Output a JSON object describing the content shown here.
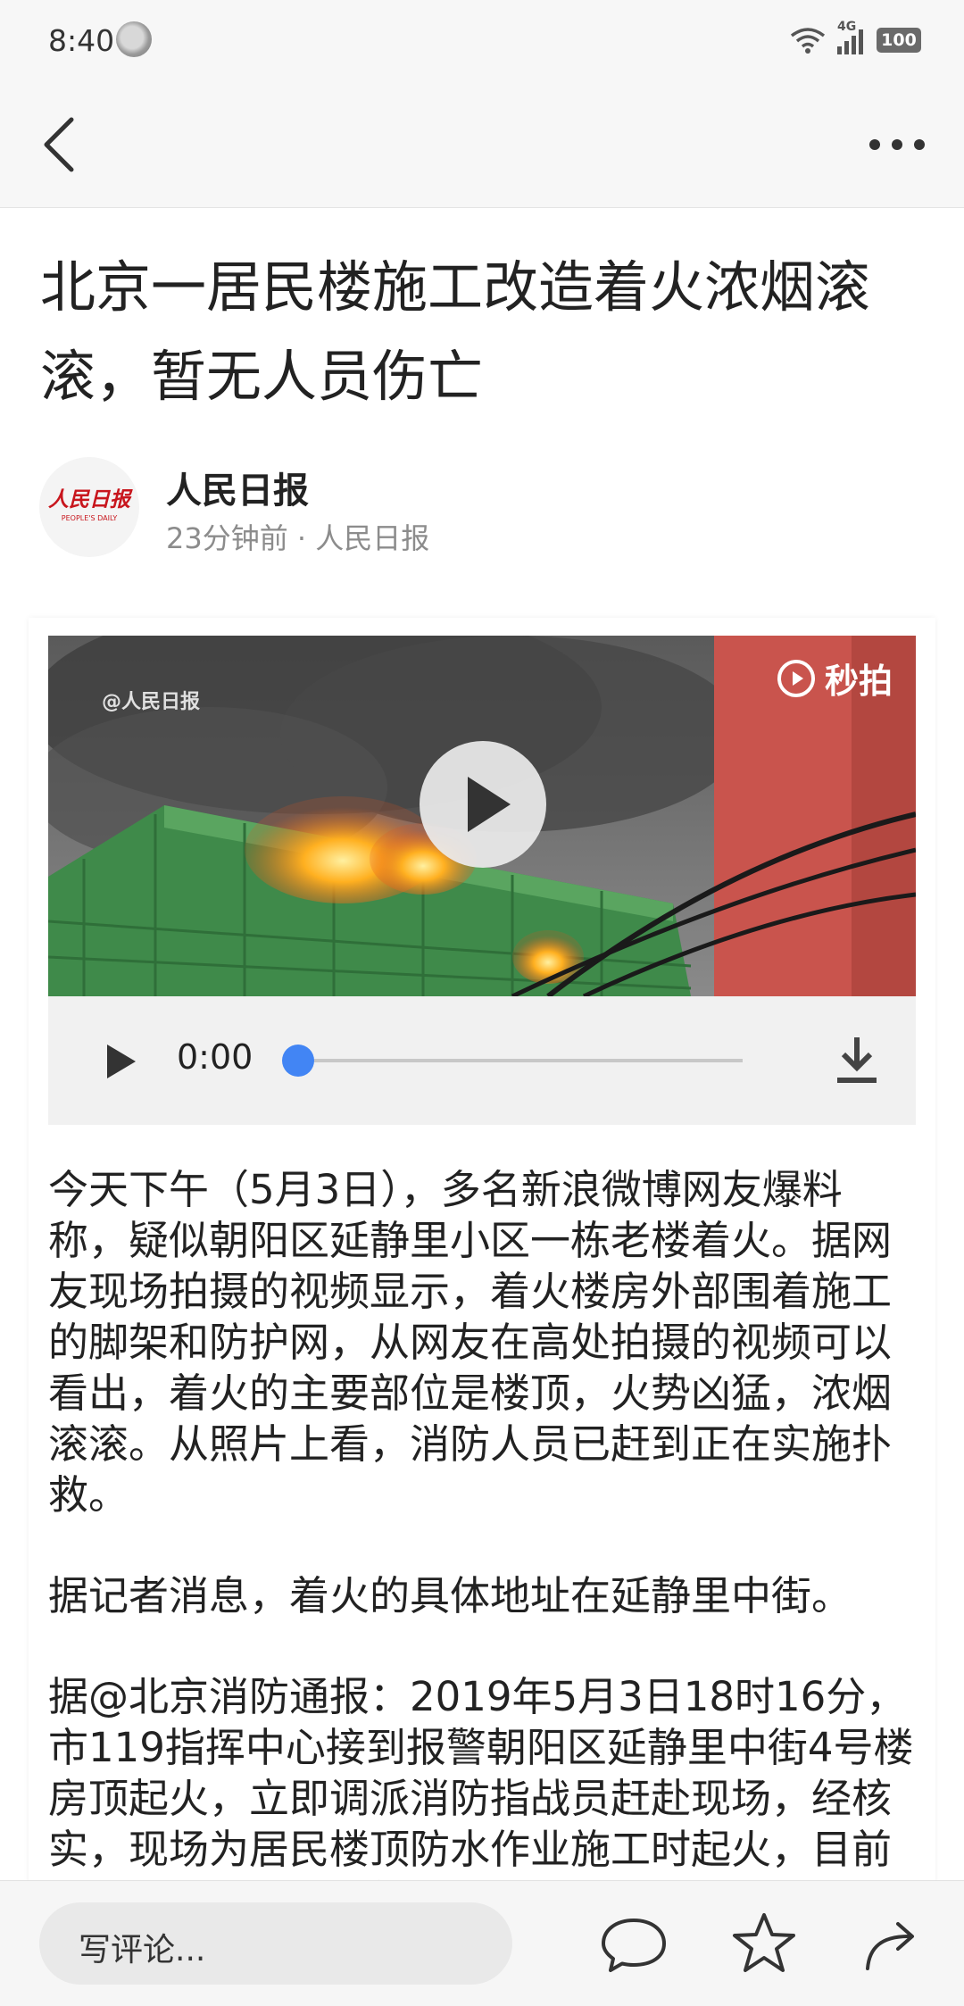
{
  "status_bar": {
    "time": "8:40",
    "network": "4G",
    "battery": "100"
  },
  "nav": {
    "back_icon": "chevron-left-icon",
    "more_icon": "more-horizontal-icon"
  },
  "article": {
    "title": "北京一居民楼施工改造着火浓烟滚滚，暂无人员伤亡",
    "source_name": "人民日报",
    "source_meta": "23分钟前 · 人民日报",
    "logo_text_cn": "人民日报",
    "logo_text_en": "PEOPLE'S DAILY"
  },
  "video": {
    "watermark_left": "@人民日报",
    "watermark_right": "秒拍",
    "current_time": "0:00",
    "progress": 0
  },
  "body": {
    "paragraphs": [
      "今天下午（5月3日），多名新浪微博网友爆料称，疑似朝阳区延静里小区一栋老楼着火。据网友现场拍摄的视频显示，着火楼房外部围着施工的脚架和防护网，从网友在高处拍摄的视频可以看出，着火的主要部位是楼顶，火势凶猛，浓烟滚滚。从照片上看，消防人员已赶到正在实施扑救。",
      "据记者消息，着火的具体地址在延静里中街。",
      "据@北京消防通报：2019年5月3日18时16分，市119指挥中心接到报警朝阳区延静里中街4号楼房顶起火，立即调派消防指战员赶赴现场，经核实，现场为居民楼顶防水作业施工时起火，目前火势已得到控制，暂无人员伤"
    ]
  },
  "bottom_bar": {
    "comment_placeholder": "写评论...",
    "icons": [
      "comment-icon",
      "star-icon",
      "share-icon"
    ]
  },
  "colors": {
    "accent": "#4285f4",
    "logo_red": "#c8161d"
  }
}
